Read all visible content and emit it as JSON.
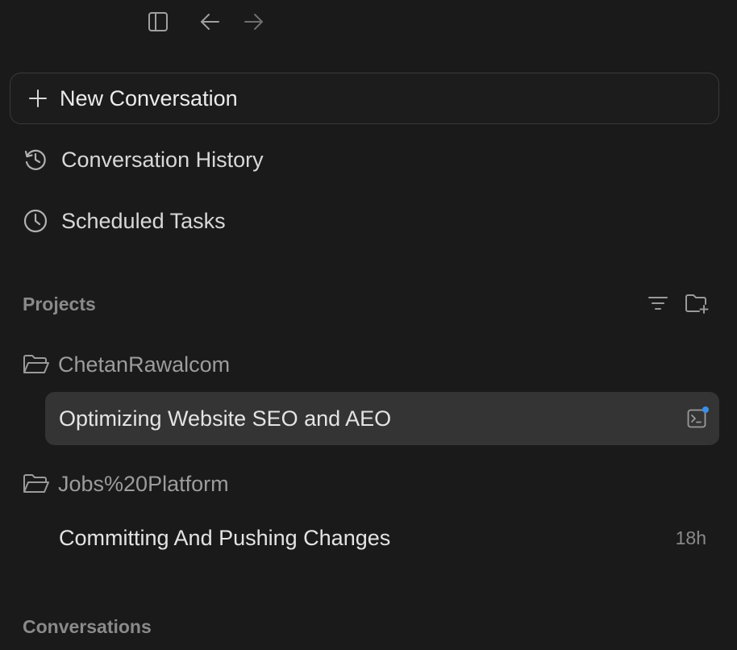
{
  "toolbar": {
    "sidebar_icon": "sidebar-toggle-icon",
    "back_icon": "arrow-left-icon",
    "forward_icon": "arrow-right-icon"
  },
  "new_conversation": {
    "label": "New Conversation",
    "icon": "plus-icon"
  },
  "nav": {
    "history": {
      "label": "Conversation History",
      "icon": "history-icon"
    },
    "scheduled": {
      "label": "Scheduled Tasks",
      "icon": "clock-icon"
    }
  },
  "projects": {
    "title": "Projects",
    "filter_icon": "filter-icon",
    "new_folder_icon": "folder-plus-icon",
    "items": [
      {
        "name": "ChetanRawalcom",
        "conversations": [
          {
            "title": "Optimizing Website SEO and AEO",
            "active": true,
            "badge_icon": "terminal-icon"
          }
        ]
      },
      {
        "name": "Jobs%20Platform",
        "conversations": [
          {
            "title": "Committing And Pushing Changes",
            "time": "18h"
          }
        ]
      }
    ]
  },
  "conversations_section": {
    "title": "Conversations"
  },
  "colors": {
    "background": "#1a1a1a",
    "active_row": "#343434",
    "accent_dot": "#3b8eea",
    "muted_text": "#8a8a8a"
  }
}
